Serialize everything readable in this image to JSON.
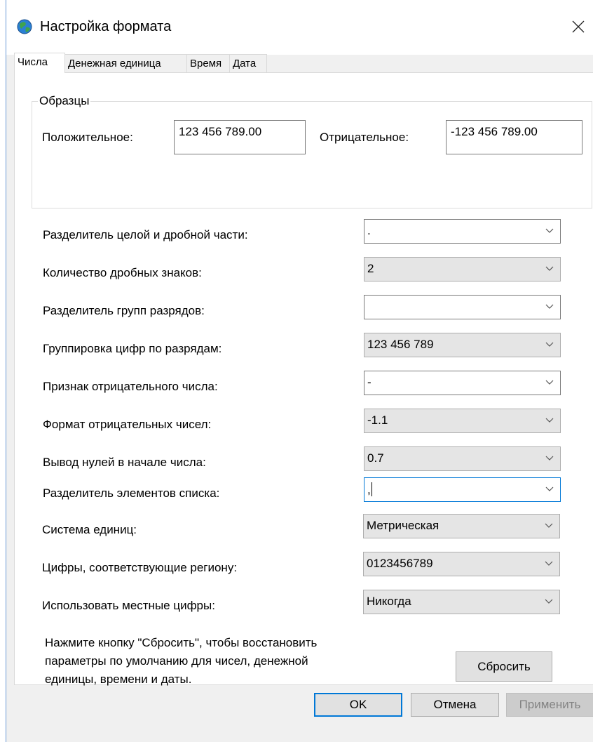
{
  "window": {
    "title": "Настройка формата",
    "close_glyph": "✕"
  },
  "tabs": [
    {
      "label": "Числа",
      "active": true
    },
    {
      "label": "Денежная единица",
      "active": false
    },
    {
      "label": "Время",
      "active": false
    },
    {
      "label": "Дата",
      "active": false
    }
  ],
  "samples": {
    "legend": "Образцы",
    "positive_label": "Положительное:",
    "positive_value": "123 456 789.00",
    "negative_label": "Отрицательное:",
    "negative_value": "-123 456 789.00"
  },
  "settings": [
    {
      "label": "Разделитель целой и дробной части:",
      "value": ".",
      "editable": true
    },
    {
      "label": "Количество дробных знаков:",
      "value": "2",
      "editable": false
    },
    {
      "label": "Разделитель групп разрядов:",
      "value": "",
      "editable": true
    },
    {
      "label": "Группировка цифр по разрядам:",
      "value": "123 456 789",
      "editable": false
    },
    {
      "label": "Признак отрицательного числа:",
      "value": "-",
      "editable": true
    },
    {
      "label": "Формат отрицательных чисел:",
      "value": "-1.1",
      "editable": false
    },
    {
      "label": "Вывод нулей в начале числа:",
      "value": "0.7",
      "editable": false
    },
    {
      "label": "Разделитель элементов списка:",
      "value": ",",
      "editable": true,
      "focused": true
    },
    {
      "label": "Система единиц:",
      "value": "Метрическая",
      "editable": false
    },
    {
      "label": "Цифры, соответствующие региону:",
      "value": "0123456789",
      "editable": false
    },
    {
      "label": "Использовать местные цифры:",
      "value": "Никогда",
      "editable": false
    }
  ],
  "note": {
    "line1": "Нажмите кнопку \"Сбросить\", чтобы восстановить",
    "line2": "параметры по умолчанию для чисел, денежной",
    "line3": "единицы, времени и даты."
  },
  "buttons": {
    "reset": "Сбросить",
    "ok": "OK",
    "cancel": "Отмена",
    "apply": "Применить"
  },
  "colors": {
    "focus_accent": "#0078d7",
    "disabled_text": "#838383"
  }
}
